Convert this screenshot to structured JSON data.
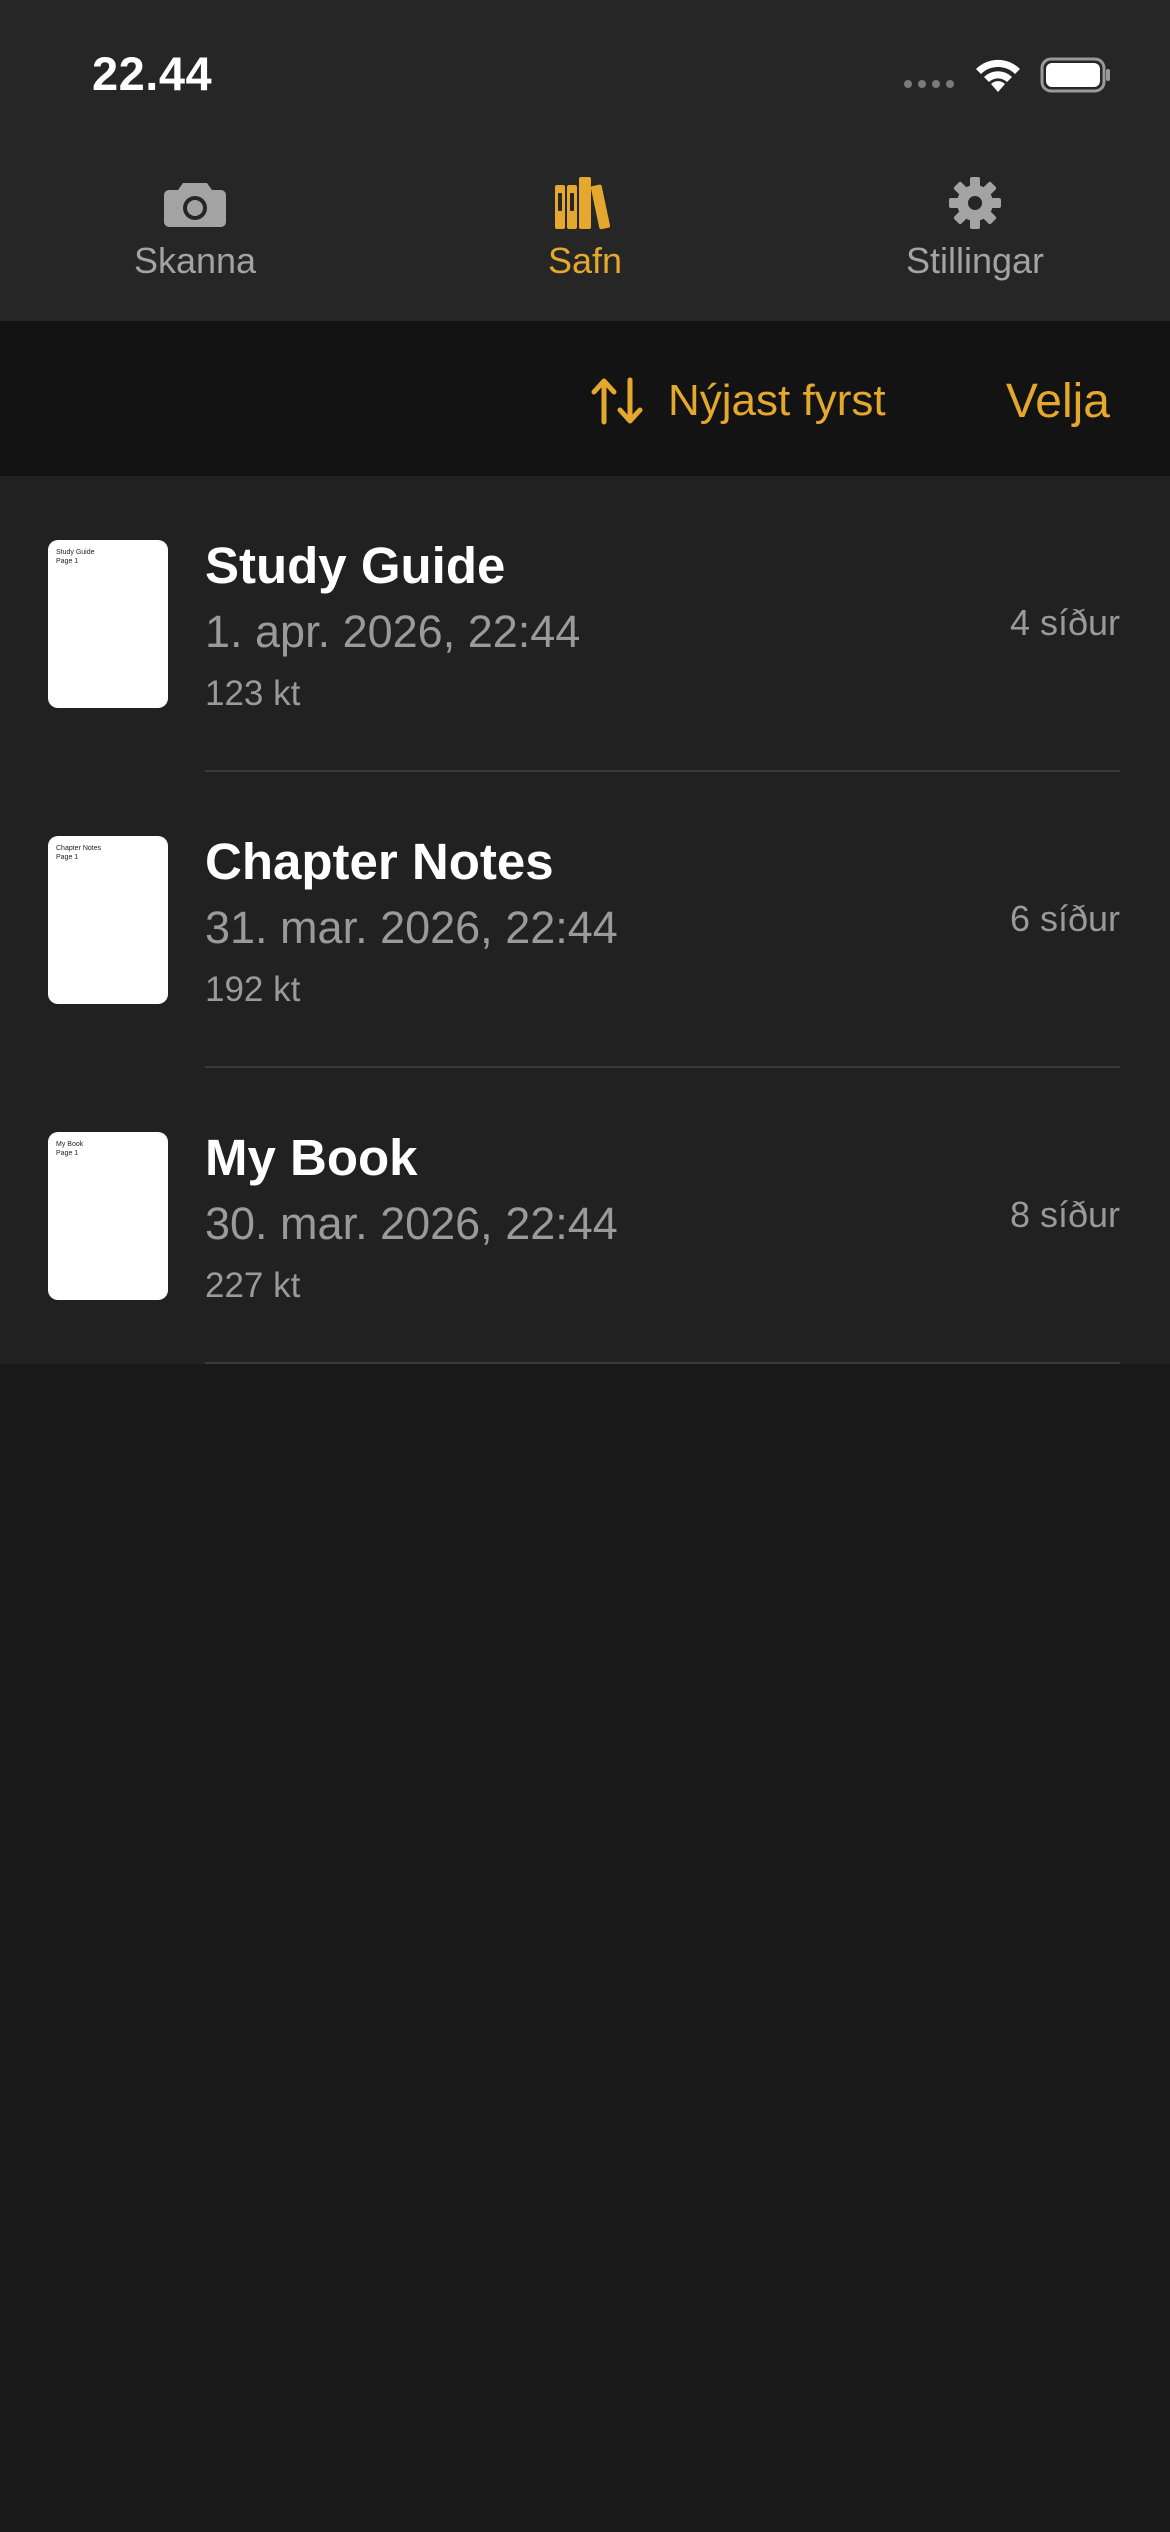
{
  "status_bar": {
    "time": "22.44"
  },
  "tabs": [
    {
      "label": "Skanna",
      "icon": "camera-icon",
      "active": false
    },
    {
      "label": "Safn",
      "icon": "books-icon",
      "active": true
    },
    {
      "label": "Stillingar",
      "icon": "gear-icon",
      "active": false
    }
  ],
  "toolbar": {
    "sort_label": "Nýjast fyrst",
    "sort_icon": "sort-arrows-icon",
    "select_label": "Velja"
  },
  "documents": [
    {
      "title": "Study Guide",
      "date": "1. apr. 2026, 22:44",
      "size": "123 kt",
      "pages": "4 síður",
      "thumb_text": "Study Guide\nPage 1"
    },
    {
      "title": "Chapter Notes",
      "date": "31. mar. 2026, 22:44",
      "size": "192 kt",
      "pages": "6 síður",
      "thumb_text": "Chapter Notes\nPage 1"
    },
    {
      "title": "My Book",
      "date": "30. mar. 2026, 22:44",
      "size": "227 kt",
      "pages": "8 síður",
      "thumb_text": "My Book\nPage 1"
    }
  ],
  "colors": {
    "accent": "#e5a82e",
    "background": "#191919",
    "bar": "#262626",
    "list": "#212121"
  }
}
